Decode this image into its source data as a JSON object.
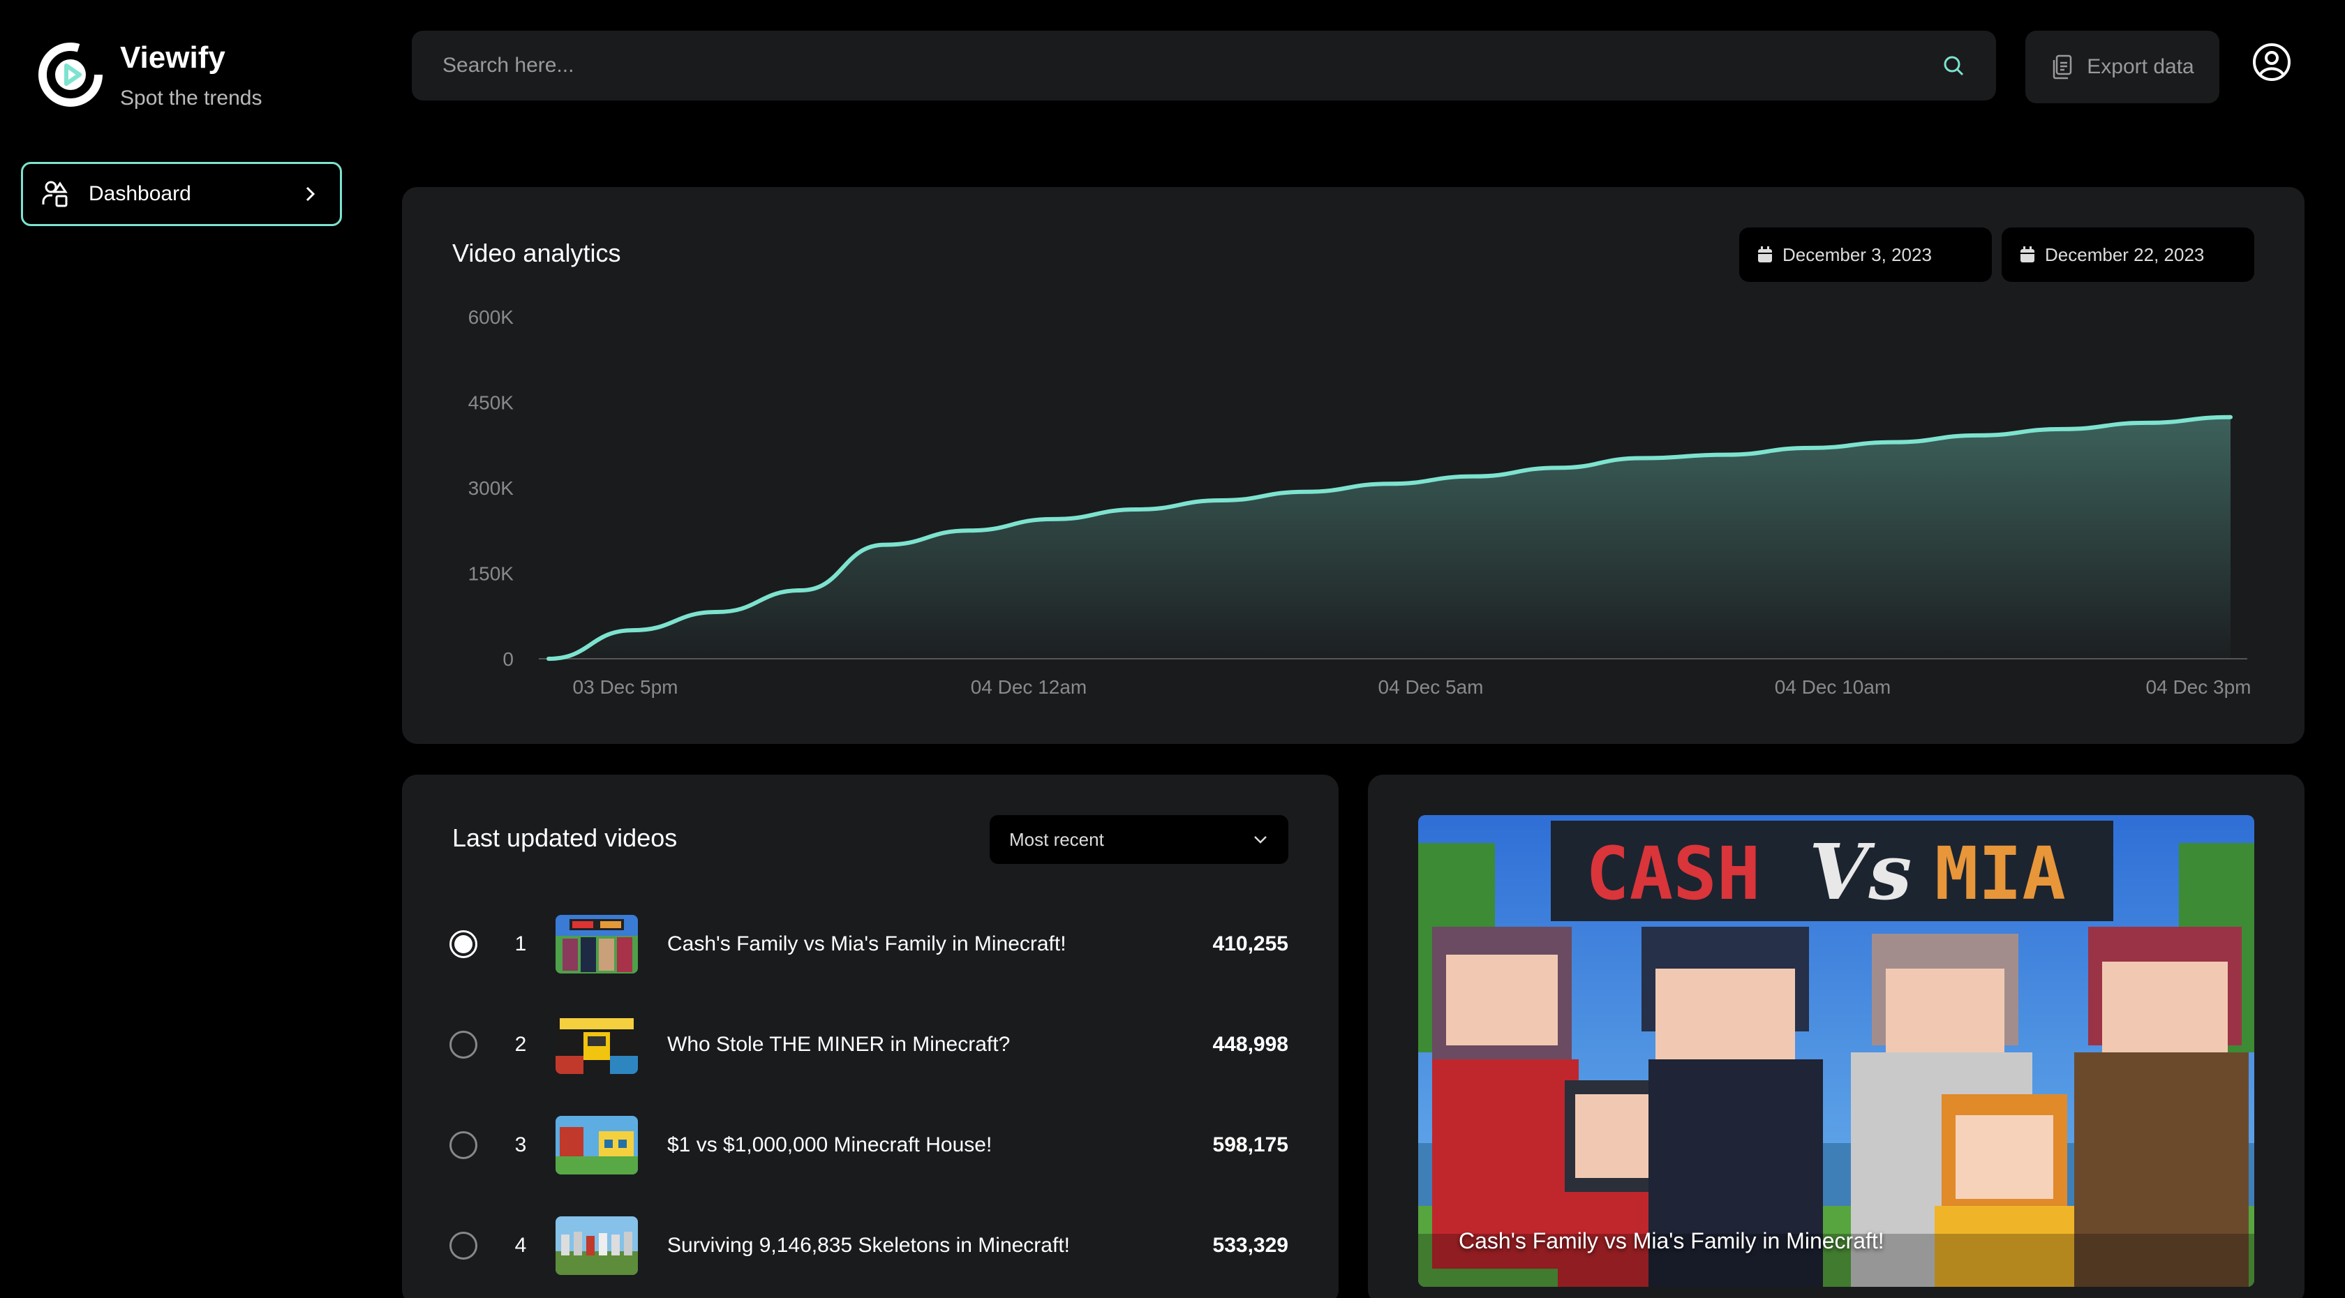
{
  "brand": {
    "name": "Viewify",
    "tagline": "Spot the trends",
    "accent": "#7de3cf"
  },
  "sidebar": {
    "items": [
      {
        "label": "Dashboard",
        "icon": "dashboard-icon",
        "active": true
      }
    ]
  },
  "header": {
    "search_placeholder": "Search here...",
    "export_label": "Export data"
  },
  "analytics": {
    "title": "Video analytics",
    "date_from": "December 3, 2023",
    "date_to": "December 22, 2023"
  },
  "chart_data": {
    "type": "area",
    "title": "Video analytics",
    "ylim": [
      0,
      600000
    ],
    "y_ticks": [
      "0",
      "150K",
      "300K",
      "450K",
      "600K"
    ],
    "x_ticks": [
      "03 Dec 5pm",
      "04 Dec 12am",
      "04 Dec 5am",
      "04 Dec 10am",
      "04 Dec 3pm"
    ],
    "x": [
      0,
      0.05,
      0.1,
      0.15,
      0.2,
      0.25,
      0.3,
      0.35,
      0.4,
      0.45,
      0.5,
      0.55,
      0.6,
      0.65,
      0.7,
      0.75,
      0.8,
      0.85,
      0.9,
      0.95,
      1.0
    ],
    "values": [
      0,
      50000,
      82000,
      120000,
      200000,
      225000,
      245000,
      262000,
      278000,
      293000,
      307000,
      320000,
      335000,
      352000,
      358000,
      370000,
      380000,
      392000,
      403000,
      414000,
      424000
    ],
    "grid": false,
    "line_color": "#7de3cf"
  },
  "videos": {
    "title": "Last updated videos",
    "sort_label": "Most recent",
    "items": [
      {
        "rank": "1",
        "title": "Cash's Family vs Mia's Family in Minecraft!",
        "views": "410,255",
        "selected": true
      },
      {
        "rank": "2",
        "title": "Who Stole THE MINER in Minecraft?",
        "views": "448,998",
        "selected": false
      },
      {
        "rank": "3",
        "title": "$1 vs $1,000,000 Minecraft House!",
        "views": "598,175",
        "selected": false
      },
      {
        "rank": "4",
        "title": "Surviving 9,146,835 Skeletons in Minecraft!",
        "views": "533,329",
        "selected": false
      }
    ]
  },
  "featured": {
    "caption": "Cash's Family vs Mia's Family in Minecraft!",
    "banner_left": "CASH",
    "banner_mid": "Vs",
    "banner_right": "MIA"
  }
}
